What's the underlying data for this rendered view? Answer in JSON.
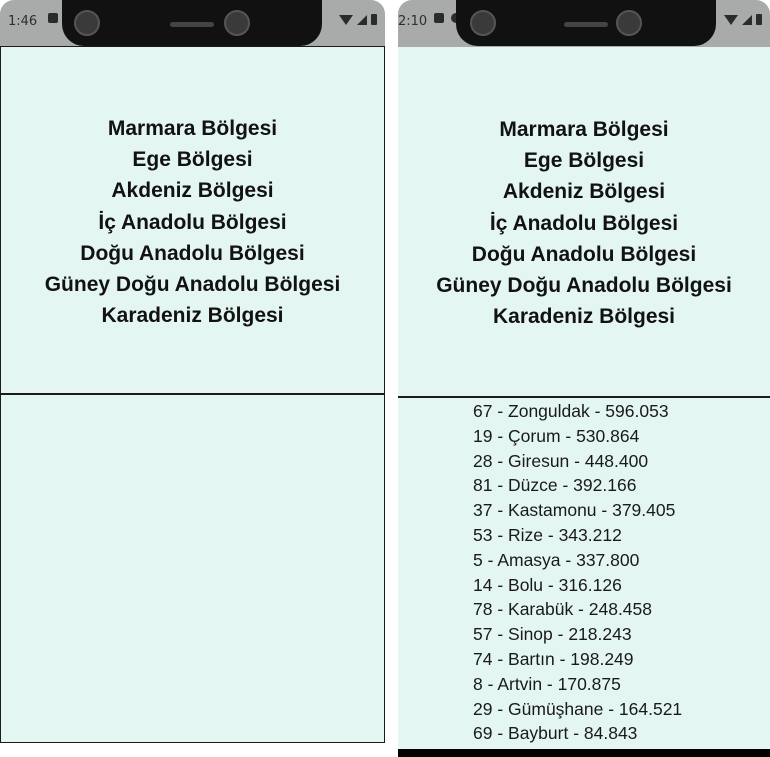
{
  "left_screen": {
    "status_time": "1:46",
    "regions": [
      "Marmara Bölgesi",
      "Ege Bölgesi",
      "Akdeniz Bölgesi",
      "İç Anadolu Bölgesi",
      "Doğu Anadolu Bölgesi",
      "Güney Doğu Anadolu Bölgesi",
      "Karadeniz Bölgesi"
    ]
  },
  "right_screen": {
    "status_time": "2:10",
    "regions": [
      "Marmara Bölgesi",
      "Ege Bölgesi",
      "Akdeniz Bölgesi",
      "İç Anadolu Bölgesi",
      "Doğu Anadolu Bölgesi",
      "Güney Doğu Anadolu Bölgesi",
      "Karadeniz Bölgesi"
    ],
    "cities": [
      "67 - Zonguldak - 596.053",
      "19 - Çorum - 530.864",
      "28 - Giresun - 448.400",
      "81 - Düzce - 392.166",
      "37 - Kastamonu - 379.405",
      "53 - Rize - 343.212",
      "5 - Amasya - 337.800",
      "14 - Bolu - 316.126",
      "78 - Karabük - 248.458",
      "57 - Sinop - 218.243",
      "74 - Bartın - 198.249",
      "8 - Artvin - 170.875",
      "29 - Gümüşhane - 164.521",
      "69 - Bayburt - 84.843"
    ]
  }
}
